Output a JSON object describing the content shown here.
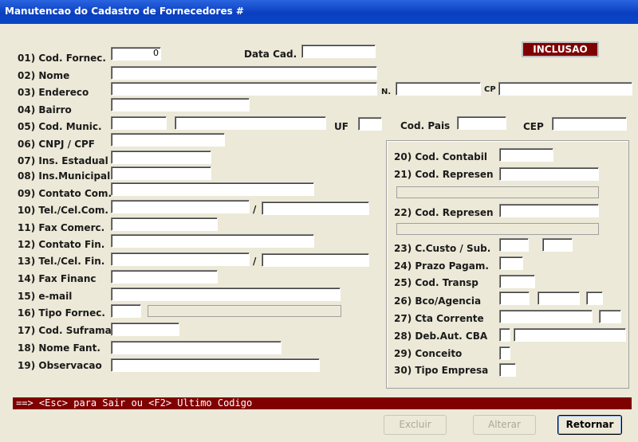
{
  "window": {
    "title": "Manutencao do Cadastro de Fornecedores #"
  },
  "mode_badge": "INCLUSAO",
  "status_hint": "==> <Esc> para Sair ou <F2> Ultimo Codigo",
  "labels": {
    "data_cad": "Data Cad.",
    "n": "N.",
    "cp": "CP",
    "uf": "UF",
    "cod_pais": "Cod. Pais",
    "cep": "CEP",
    "slash": "/"
  },
  "fields_left": [
    {
      "label": "01)  Cod. Fornec."
    },
    {
      "label": "02)  Nome"
    },
    {
      "label": "03)  Endereco"
    },
    {
      "label": "04)  Bairro"
    },
    {
      "label": "05)  Cod. Munic."
    },
    {
      "label": "06)  CNPJ / CPF"
    },
    {
      "label": "07)  Ins. Estadual"
    },
    {
      "label": "08)  Ins.Municipal"
    },
    {
      "label": "09)  Contato Com."
    },
    {
      "label": "10)  Tel./Cel.Com."
    },
    {
      "label": "11)  Fax Comerc."
    },
    {
      "label": "12)  Contato Fin."
    },
    {
      "label": "13)  Tel./Cel. Fin."
    },
    {
      "label": "14)  Fax Financ"
    },
    {
      "label": "15)  e-mail"
    },
    {
      "label": "16)  Tipo Fornec."
    },
    {
      "label": "17)  Cod. Suframa"
    },
    {
      "label": "18)  Nome Fant."
    },
    {
      "label": "19)  Observacao"
    }
  ],
  "fields_right": [
    {
      "label": "20)  Cod. Contabil"
    },
    {
      "label": "21)  Cod. Represen"
    },
    {
      "label": "22)  Cod. Represen"
    },
    {
      "label": "23)  C.Custo / Sub."
    },
    {
      "label": "24)  Prazo Pagam."
    },
    {
      "label": "25)  Cod. Transp"
    },
    {
      "label": "26)  Bco/Agencia"
    },
    {
      "label": "27)  Cta Corrente"
    },
    {
      "label": "28)  Deb.Aut. CBA"
    },
    {
      "label": "29)  Conceito"
    },
    {
      "label": "30)  Tipo Empresa"
    }
  ],
  "values": {
    "cod_fornec": "0"
  },
  "buttons": {
    "excluir": "Excluir",
    "alterar": "Alterar",
    "retornar": "Retornar"
  }
}
